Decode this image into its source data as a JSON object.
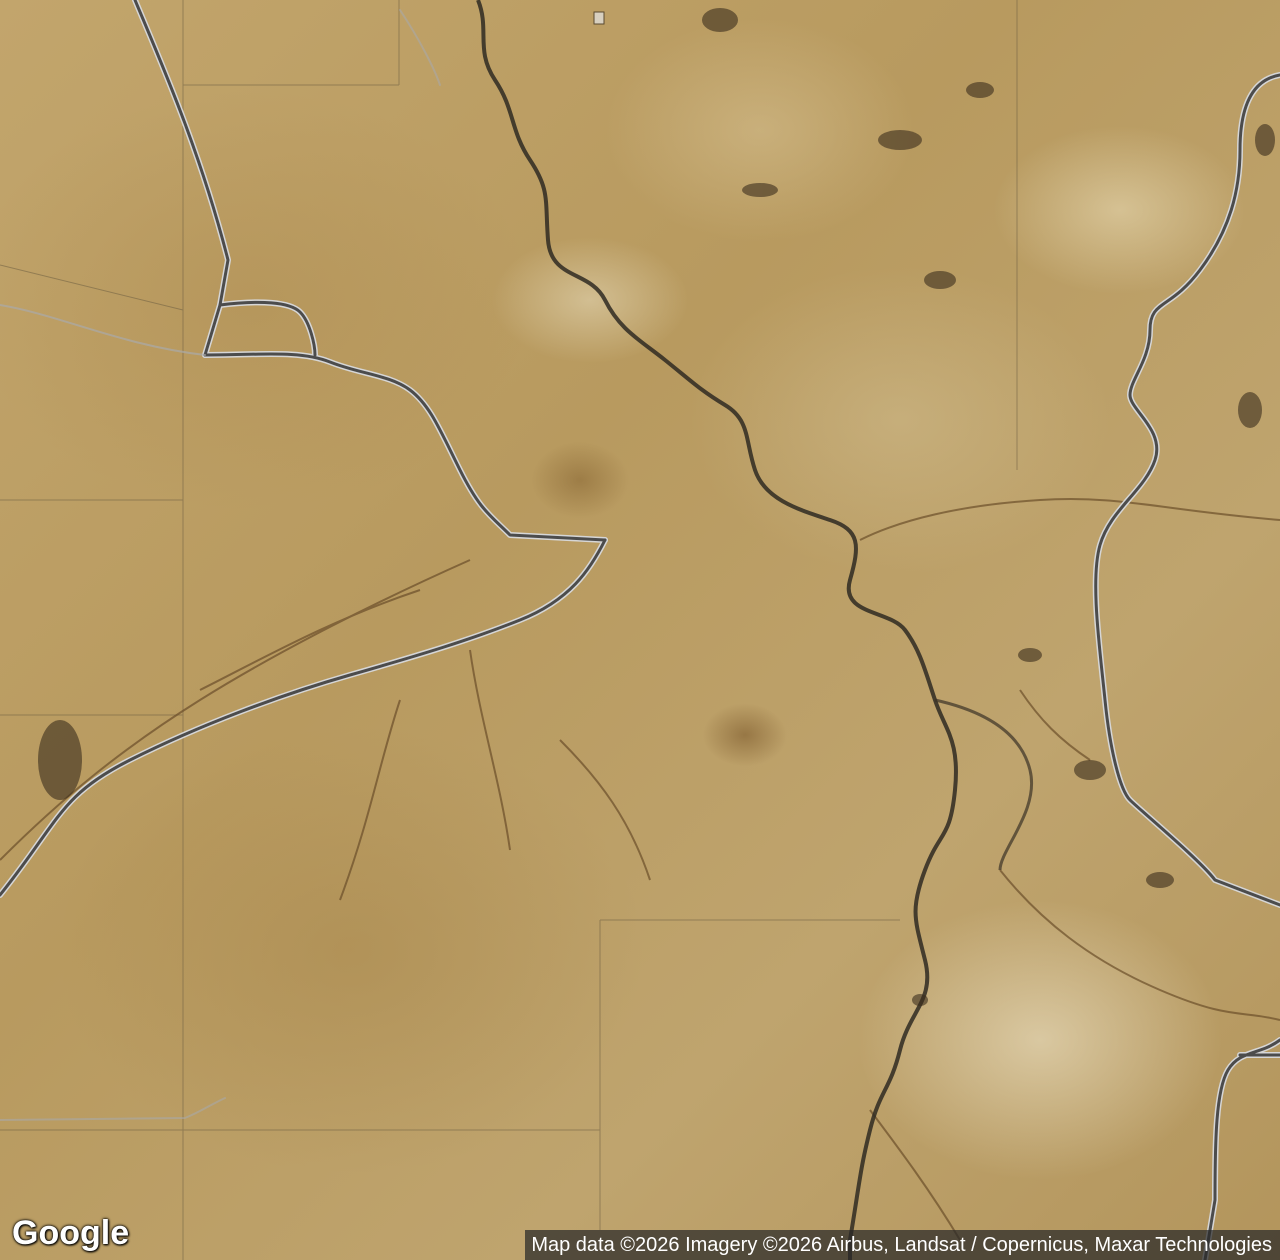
{
  "map": {
    "type": "satellite",
    "logo": "Google",
    "attribution": "Map data ©2026 Imagery ©2026 Airbus, Landsat / Copernicus, Maxar Technologies",
    "colors": {
      "terrain": "#b89a5f",
      "light_terrain": "#e6dcc0",
      "river": "#2f2a22",
      "road": "#4c4c4c",
      "road_outline": "#d8d8d8",
      "parcel_line": "#7a6a4a"
    }
  }
}
